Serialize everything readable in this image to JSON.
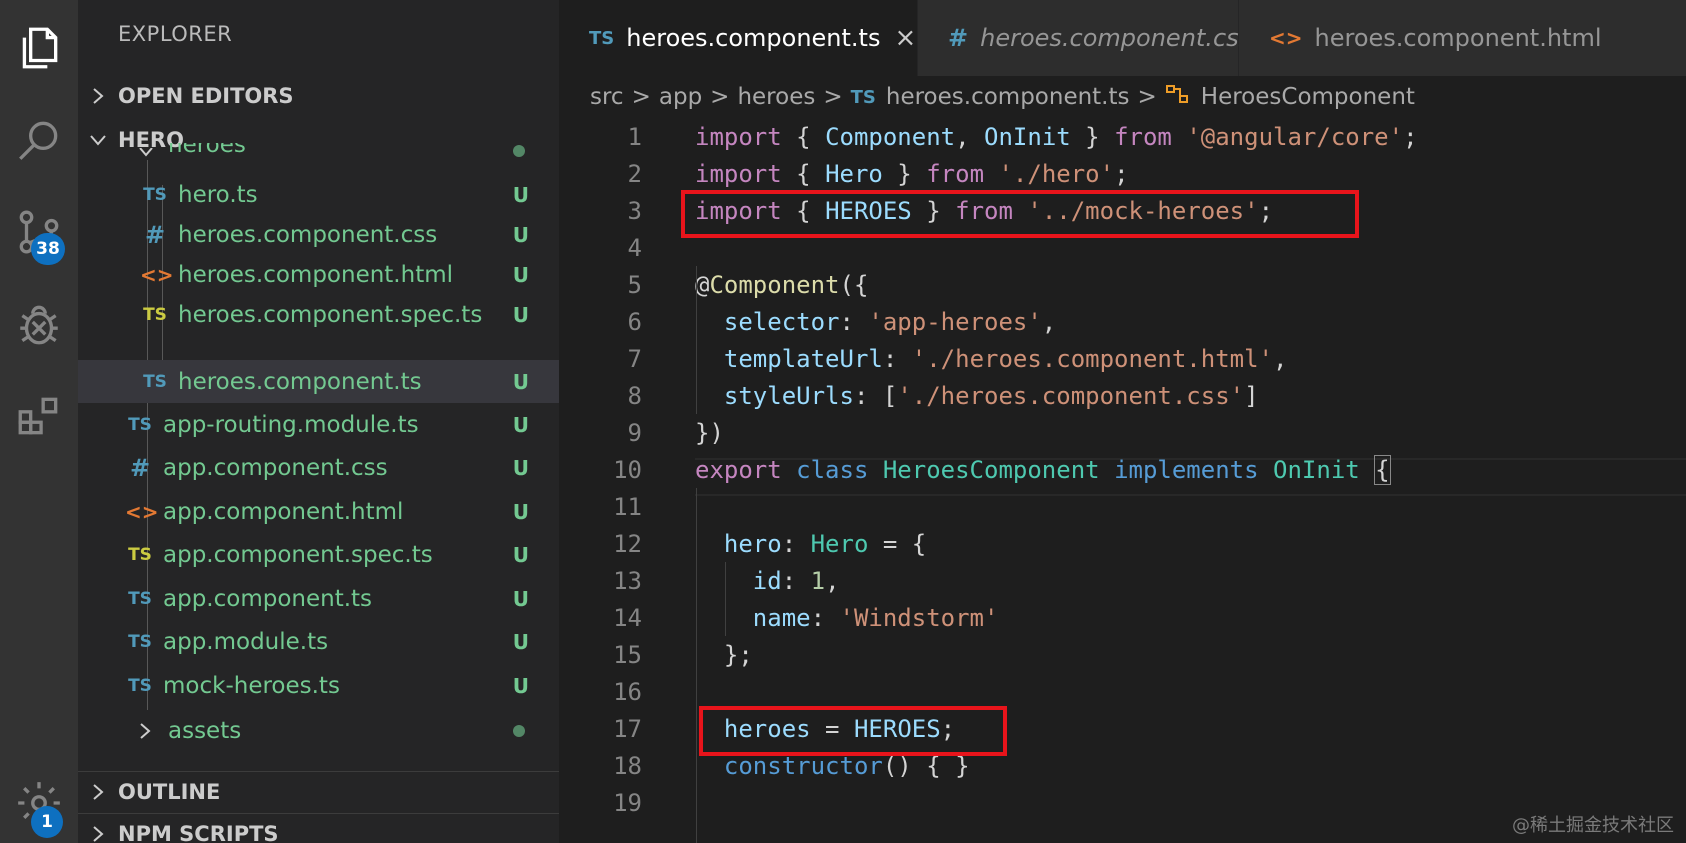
{
  "activity_bar": {
    "scm_badge": "38",
    "settings_badge": "1"
  },
  "sidebar": {
    "title": "EXPLORER",
    "open_editors": "OPEN EDITORS",
    "project": "HERO",
    "outline": "OUTLINE",
    "npm_scripts": "NPM SCRIPTS",
    "tree": [
      {
        "name": "heroes",
        "icon": "",
        "status": ""
      },
      {
        "name": "hero.ts",
        "icon": "TS",
        "status": "U"
      },
      {
        "name": "heroes.component.css",
        "icon": "#",
        "status": "U"
      },
      {
        "name": "heroes.component.html",
        "icon": "<>",
        "status": "U"
      },
      {
        "name": "heroes.component.spec.ts",
        "icon": "TS",
        "status": "U"
      },
      {
        "name": "heroes.component.ts",
        "icon": "TS",
        "status": "U"
      },
      {
        "name": "app-routing.module.ts",
        "icon": "TS",
        "status": "U"
      },
      {
        "name": "app.component.css",
        "icon": "#",
        "status": "U"
      },
      {
        "name": "app.component.html",
        "icon": "<>",
        "status": "U"
      },
      {
        "name": "app.component.spec.ts",
        "icon": "TS",
        "status": "U"
      },
      {
        "name": "app.component.ts",
        "icon": "TS",
        "status": "U"
      },
      {
        "name": "app.module.ts",
        "icon": "TS",
        "status": "U"
      },
      {
        "name": "mock-heroes.ts",
        "icon": "TS",
        "status": "U"
      },
      {
        "name": "assets",
        "icon": "",
        "status": ""
      }
    ]
  },
  "tabs": [
    {
      "icon": "TS",
      "label": "heroes.component.ts",
      "close": "×"
    },
    {
      "icon": "#",
      "label": "heroes.component.css"
    },
    {
      "icon": "<>",
      "label": "heroes.component.html"
    }
  ],
  "breadcrumb": {
    "parts": [
      "src",
      "app",
      "heroes"
    ],
    "file_icon": "TS",
    "file": "heroes.component.ts",
    "symbol": "HeroesComponent",
    "sep": ">"
  },
  "code": {
    "line_numbers": [
      "1",
      "2",
      "3",
      "4",
      "5",
      "6",
      "7",
      "8",
      "9",
      "10",
      "11",
      "12",
      "13",
      "14",
      "15",
      "16",
      "17",
      "18",
      "19"
    ],
    "l1": [
      "import",
      " { ",
      "Component",
      ", ",
      "OnInit",
      " } ",
      "from",
      " ",
      "'@angular/core'",
      ";"
    ],
    "l2": [
      "import",
      " { ",
      "Hero",
      " } ",
      "from",
      " ",
      "'./hero'",
      ";"
    ],
    "l3": [
      "import",
      " { ",
      "HEROES",
      " } ",
      "from",
      " ",
      "'../mock-heroes'",
      ";"
    ],
    "l5": [
      "@",
      "Component",
      "({"
    ],
    "l6": [
      "  ",
      "selector",
      ": ",
      "'app-heroes'",
      ","
    ],
    "l7": [
      "  ",
      "templateUrl",
      ": ",
      "'./heroes.component.html'",
      ","
    ],
    "l8": [
      "  ",
      "styleUrls",
      ": [",
      "'./heroes.component.css'",
      "]"
    ],
    "l9": [
      "})"
    ],
    "l10": [
      "export",
      " ",
      "class",
      " ",
      "HeroesComponent",
      " ",
      "implements",
      " ",
      "OnInit",
      " ",
      "{"
    ],
    "l12": [
      "  ",
      "hero",
      ": ",
      "Hero",
      " = {"
    ],
    "l13": [
      "    ",
      "id",
      ": ",
      "1",
      ","
    ],
    "l14": [
      "    ",
      "name",
      ": ",
      "'Windstorm'"
    ],
    "l15": [
      "  };"
    ],
    "l17": [
      "  ",
      "heroes",
      " = ",
      "HEROES",
      ";"
    ],
    "l18": [
      "  ",
      "constructor",
      "() { }"
    ]
  },
  "watermark": "@稀土掘金技术社区",
  "colors": {
    "highlight": "#e8141b",
    "accent": "#0e70c0",
    "untracked": "#73c991"
  }
}
